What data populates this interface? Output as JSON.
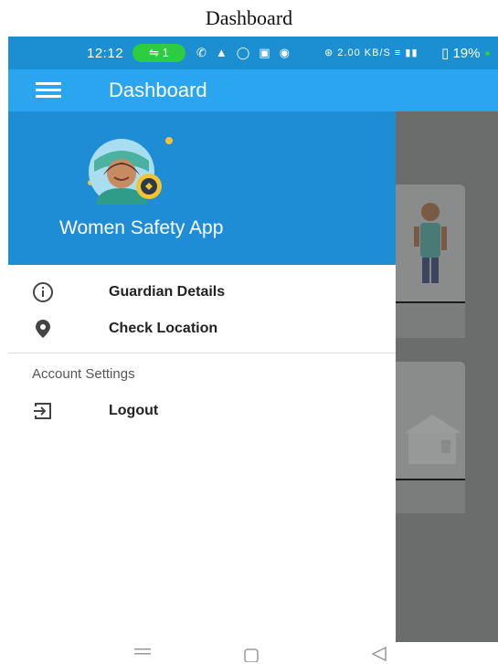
{
  "caption": "Dashboard",
  "status_bar": {
    "time": "12:12",
    "sim_badge": "1",
    "speed": "2.00",
    "speed_unit": "KB/S",
    "battery": "19%"
  },
  "app_bar": {
    "title": "Dashboard",
    "menu_icon": "hamburger-icon"
  },
  "drawer": {
    "app_name": "Women Safety App",
    "items": [
      {
        "label": "Guardian Details",
        "icon": "info-icon"
      },
      {
        "label": "Check Location",
        "icon": "location-pin-icon"
      }
    ],
    "section_title": "Account Settings",
    "section_items": [
      {
        "label": "Logout",
        "icon": "logout-icon"
      }
    ]
  },
  "colors": {
    "status_bar": "#1c8fd3",
    "app_bar": "#2aa6f0",
    "drawer_header": "#1e8dd6",
    "scrim": "#6b6d6d"
  }
}
